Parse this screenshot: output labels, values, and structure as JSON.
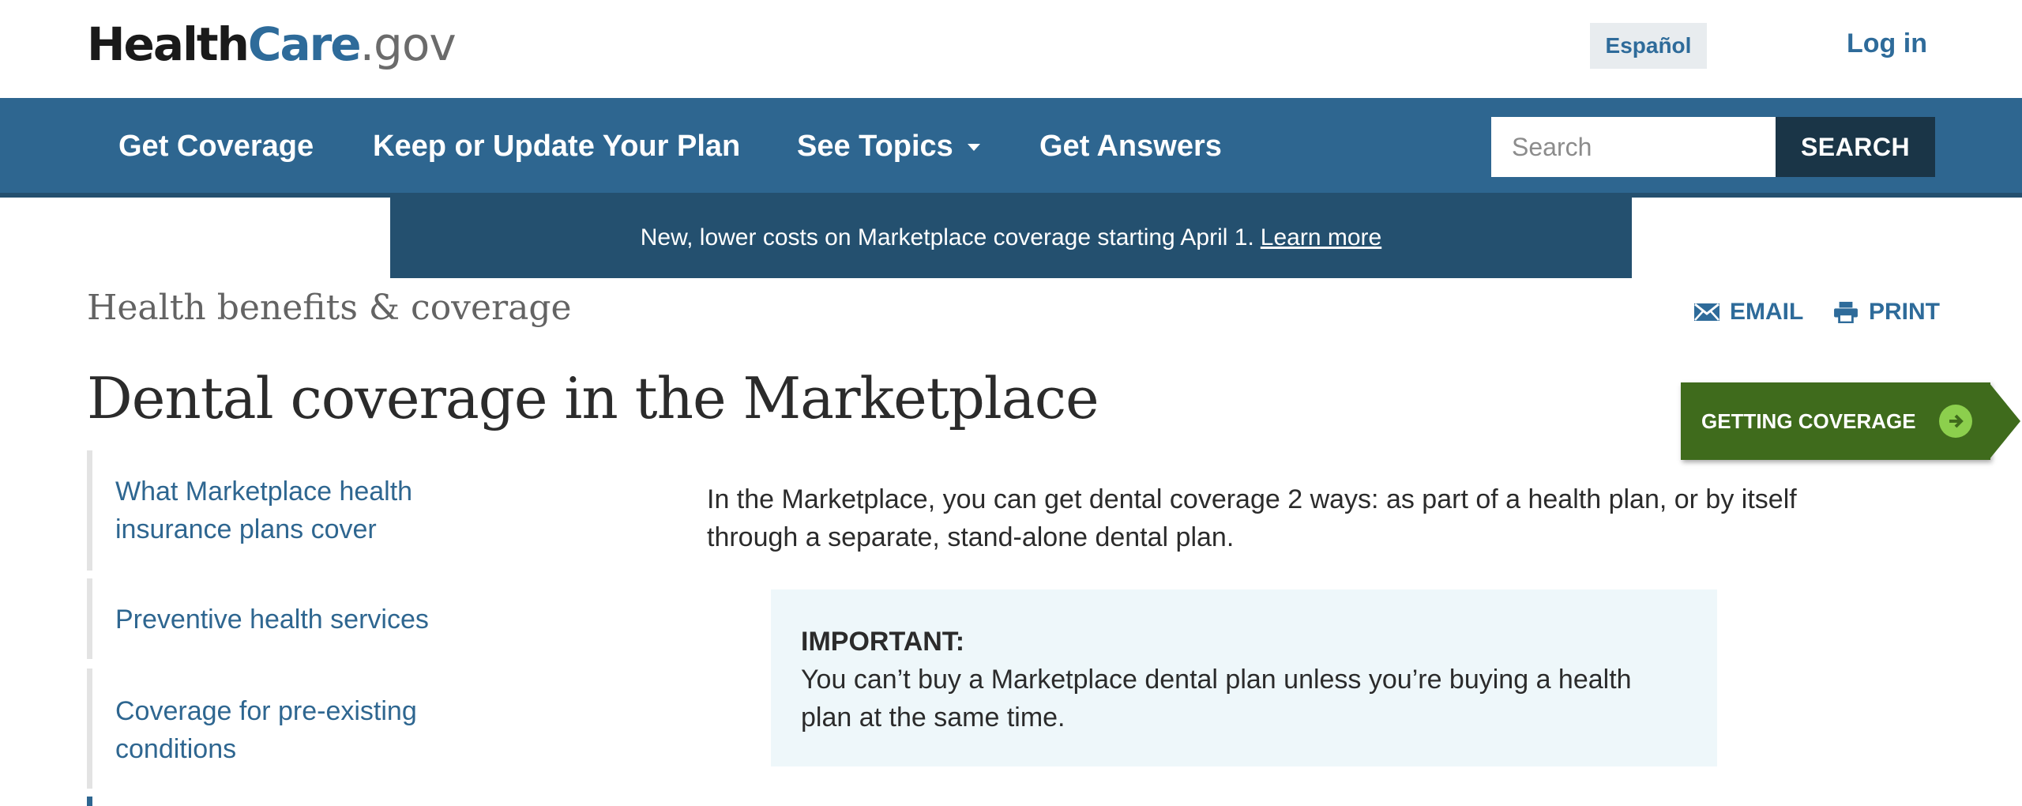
{
  "header": {
    "logo": {
      "part1": "Health",
      "part2": "Care",
      "part3": ".gov"
    },
    "espanol_label": "Español",
    "login_label": "Log in"
  },
  "nav": {
    "items": [
      {
        "label": "Get Coverage"
      },
      {
        "label": "Keep or Update Your Plan"
      },
      {
        "label": "See Topics"
      },
      {
        "label": "Get Answers"
      }
    ],
    "search": {
      "placeholder": "Search",
      "button_label": "SEARCH"
    }
  },
  "alert": {
    "text": "New, lower costs on Marketplace coverage starting April 1.",
    "link_label": "Learn more",
    "close_glyph": "✕"
  },
  "page": {
    "eyebrow": "Health benefits & coverage",
    "title": "Dental coverage in the Marketplace",
    "actions": {
      "email_label": "EMAIL",
      "print_label": "PRINT"
    },
    "getting_coverage_label": "GETTING COVERAGE"
  },
  "sidebar": {
    "items": [
      {
        "label": "What Marketplace health insurance plans cover"
      },
      {
        "label": "Preventive health services"
      },
      {
        "label": "Coverage for pre-existing conditions"
      }
    ]
  },
  "main": {
    "intro": "In the Marketplace, you can get dental coverage 2 ways: as part of a health plan, or by itself through a separate, stand-alone dental plan.",
    "important": {
      "heading": "IMPORTANT:",
      "body": "You can’t buy a Marketplace dental plan unless you’re buying a health plan at the same time."
    }
  },
  "colors": {
    "brand_blue": "#2e6690",
    "alert_bg": "#24506f",
    "cta_green": "#3f6b1c",
    "callout_bg": "#eef7fa"
  },
  "icons": [
    "email-icon",
    "print-icon",
    "close-icon",
    "arrow-right-icon",
    "chevron-down-icon"
  ]
}
